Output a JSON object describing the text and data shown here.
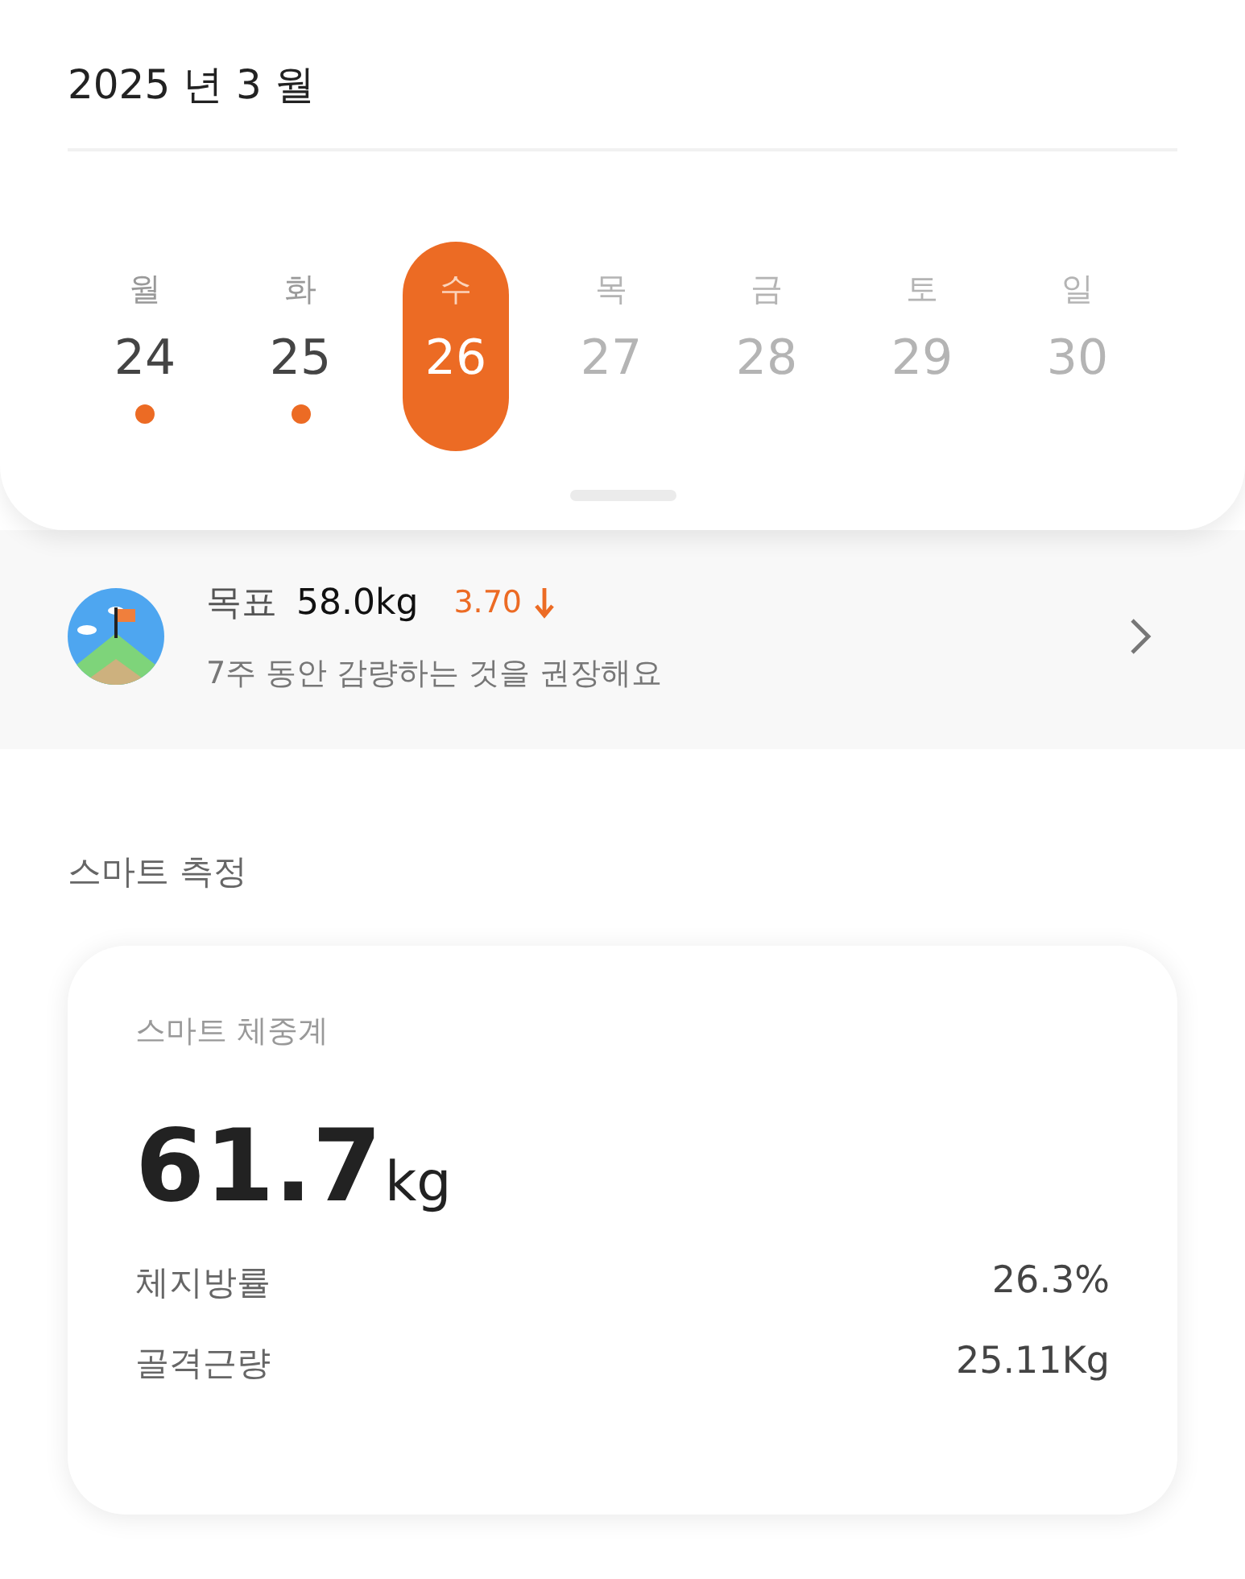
{
  "header": {
    "month_title": "2025 년  3 월"
  },
  "days": [
    {
      "weekday": "월",
      "date": "24",
      "selected": false,
      "has_record": true,
      "disabled": false
    },
    {
      "weekday": "화",
      "date": "25",
      "selected": false,
      "has_record": true,
      "disabled": false
    },
    {
      "weekday": "수",
      "date": "26",
      "selected": true,
      "has_record": false,
      "disabled": false
    },
    {
      "weekday": "목",
      "date": "27",
      "selected": false,
      "has_record": false,
      "disabled": true
    },
    {
      "weekday": "금",
      "date": "28",
      "selected": false,
      "has_record": false,
      "disabled": true
    },
    {
      "weekday": "토",
      "date": "29",
      "selected": false,
      "has_record": false,
      "disabled": true
    },
    {
      "weekday": "일",
      "date": "30",
      "selected": false,
      "has_record": false,
      "disabled": true
    }
  ],
  "goal": {
    "label": "목표",
    "target": "58.0kg",
    "difference": "3.70",
    "decreasing": true,
    "subtitle": "7주 동안 감량하는 것을 권장해요"
  },
  "section_title": "스마트 측정",
  "scale_card": {
    "title": "스마트 체중계",
    "weight": "61.7",
    "unit": "kg",
    "metrics": [
      {
        "label": "체지방률",
        "value": "26.3%"
      },
      {
        "label": "골격근량",
        "value": "25.11Kg"
      }
    ]
  }
}
